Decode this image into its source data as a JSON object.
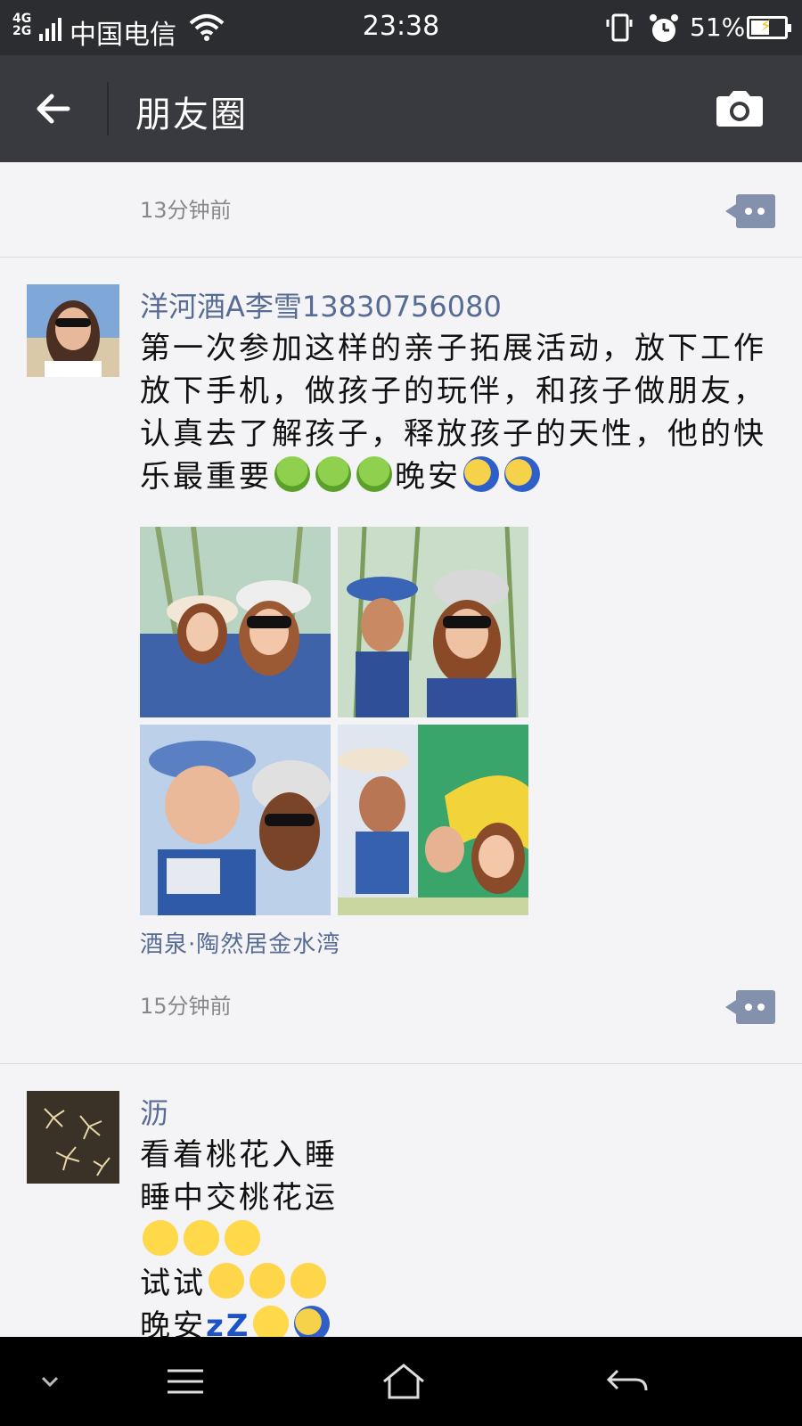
{
  "status_bar": {
    "network": "4G\n2G",
    "carrier": "中国电信",
    "time": "23:38",
    "battery_percent": "51%",
    "battery_level": 0.51
  },
  "nav": {
    "title": "朋友圈",
    "back_icon": "arrow-left-icon",
    "camera_icon": "camera-icon"
  },
  "posts": [
    {
      "timestamp": "13分钟前"
    },
    {
      "author": "洋河酒A李雪13830756080",
      "text": "第一次参加这样的亲子拓展活动，放下工作放下手机，做孩子的玩伴，和孩子做朋友，认真去了解孩子，释放孩子的天性，他的快乐最重要",
      "text_suffix": "晚安",
      "location": "酒泉·陶然居金水湾",
      "timestamp": "15分钟前",
      "photo_count": 4
    },
    {
      "author": "沥",
      "lines": [
        "看着桃花入睡",
        "睡中交桃花运",
        "",
        "试试",
        "晚安"
      ],
      "sleep_suffix": "zZ"
    }
  ],
  "colors": {
    "status_bg": "#2c2d31",
    "nav_bg": "#393a3f",
    "link": "#576b95",
    "feed_bg": "#f4f4f6",
    "comment_btn": "#8391ad"
  },
  "system_nav": [
    "chevron-down-icon",
    "menu-icon",
    "home-icon",
    "back-icon"
  ]
}
